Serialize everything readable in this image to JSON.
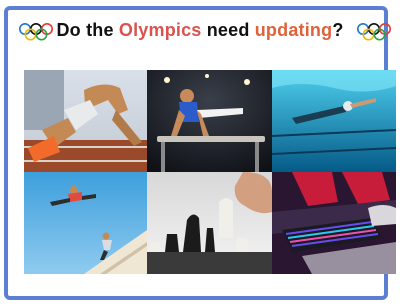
{
  "title": {
    "part1": "Do the ",
    "highlight1": "Olympics",
    "part2": " need ",
    "highlight2": "updating",
    "part3": "?"
  },
  "colors": {
    "frame_border": "#5b7fd1",
    "highlight_red": "#d9534f",
    "highlight_orange": "#e0623a",
    "ring_blue": "#1f78c8",
    "ring_black": "#111111",
    "ring_red": "#e53935",
    "ring_yellow": "#f2b705",
    "ring_green": "#2e9e48"
  },
  "tiles": [
    {
      "name": "sprinter-start"
    },
    {
      "name": "gymnast-pommel"
    },
    {
      "name": "swimmer"
    },
    {
      "name": "parkour-jump"
    },
    {
      "name": "chess"
    },
    {
      "name": "esports-keyboards"
    }
  ]
}
